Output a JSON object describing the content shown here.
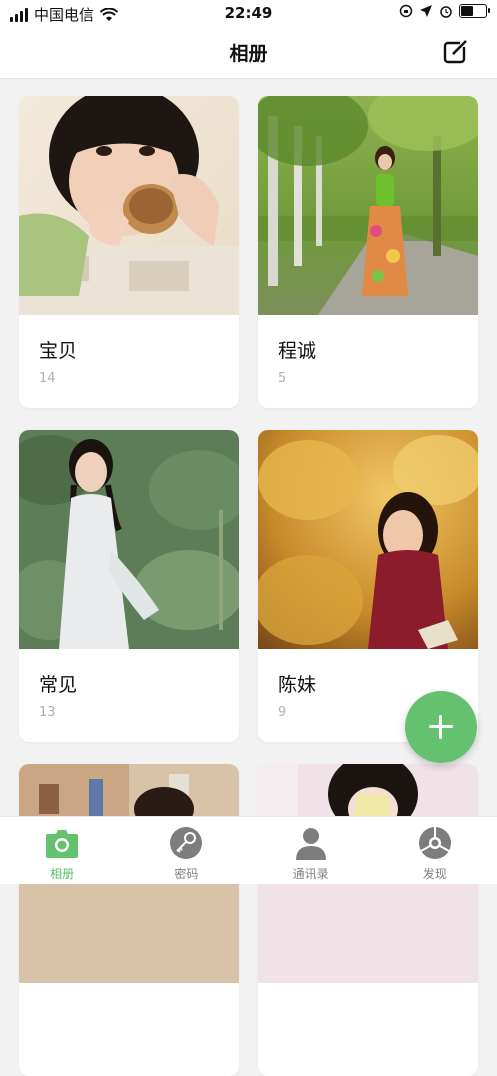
{
  "status_bar": {
    "carrier": "中国电信",
    "time": "22:49",
    "battery_level": 0.55
  },
  "nav": {
    "title": "相册",
    "edit_icon": "edit-icon"
  },
  "albums": [
    {
      "name": "宝贝",
      "count": "14"
    },
    {
      "name": "程诚",
      "count": "5"
    },
    {
      "name": "常见",
      "count": "13"
    },
    {
      "name": "陈妹",
      "count": "9"
    },
    {
      "name": "",
      "count": ""
    },
    {
      "name": "",
      "count": ""
    }
  ],
  "fab": {
    "icon": "plus-icon",
    "color": "#64c26f"
  },
  "tabs": [
    {
      "label": "相册",
      "icon": "camera-icon",
      "active": true
    },
    {
      "label": "密码",
      "icon": "key-icon",
      "active": false
    },
    {
      "label": "通讯录",
      "icon": "person-icon",
      "active": false
    },
    {
      "label": "发现",
      "icon": "compass-icon",
      "active": false
    }
  ],
  "colors": {
    "accent": "#5bbd6a",
    "inactive": "#808080"
  }
}
